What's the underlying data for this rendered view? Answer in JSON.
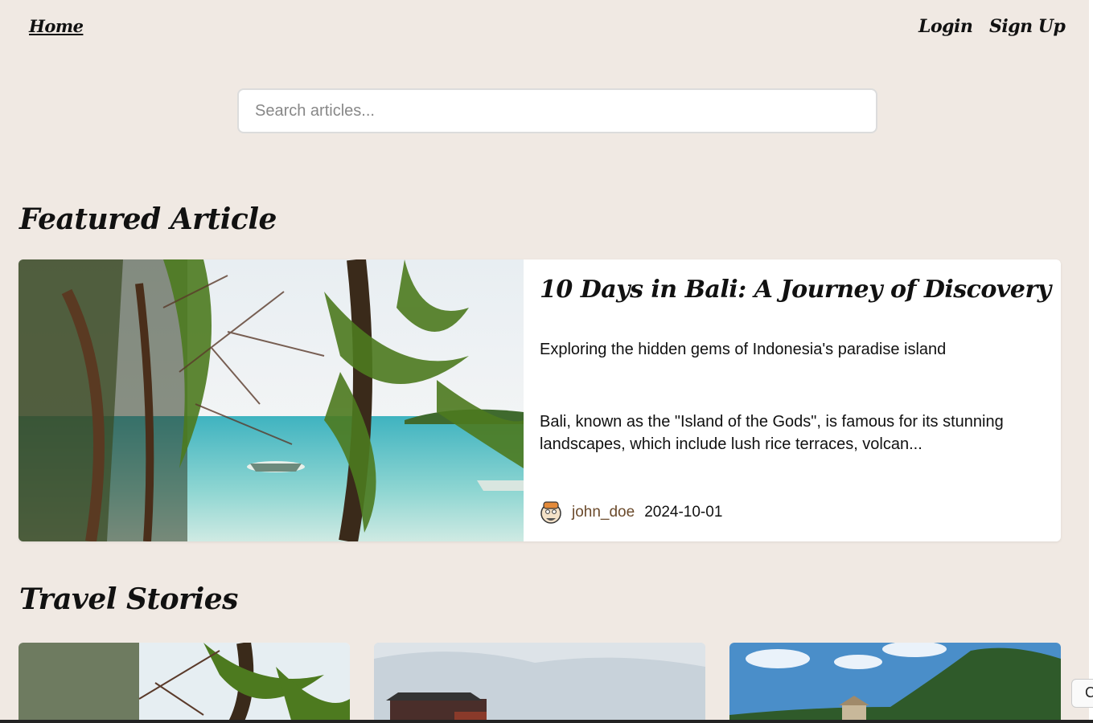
{
  "nav": {
    "home": "Home",
    "login": "Login",
    "signup": "Sign Up"
  },
  "search": {
    "placeholder": "Search articles..."
  },
  "featured_section": {
    "heading": "Featured Article",
    "article": {
      "title": "10 Days in Bali: A Journey of Discovery",
      "subtitle": "Exploring the hidden gems of Indonesia's paradise island",
      "excerpt": "Bali, known as the \"Island of the Gods\", is famous for its stunning landscapes, which include lush rice terraces, volcan...",
      "author": "john_doe",
      "date": "2024-10-01",
      "image": "tropical-beach-palm-image"
    }
  },
  "stories_section": {
    "heading": "Travel Stories",
    "cards": [
      {
        "image": "tropical-beach-palm-image"
      },
      {
        "image": "waterfront-house-image"
      },
      {
        "image": "mountain-island-image"
      }
    ]
  },
  "corner_button": {
    "label": "C"
  },
  "colors": {
    "background": "#f0e9e3",
    "author_link": "#6b4a2b",
    "card": "#ffffff"
  }
}
